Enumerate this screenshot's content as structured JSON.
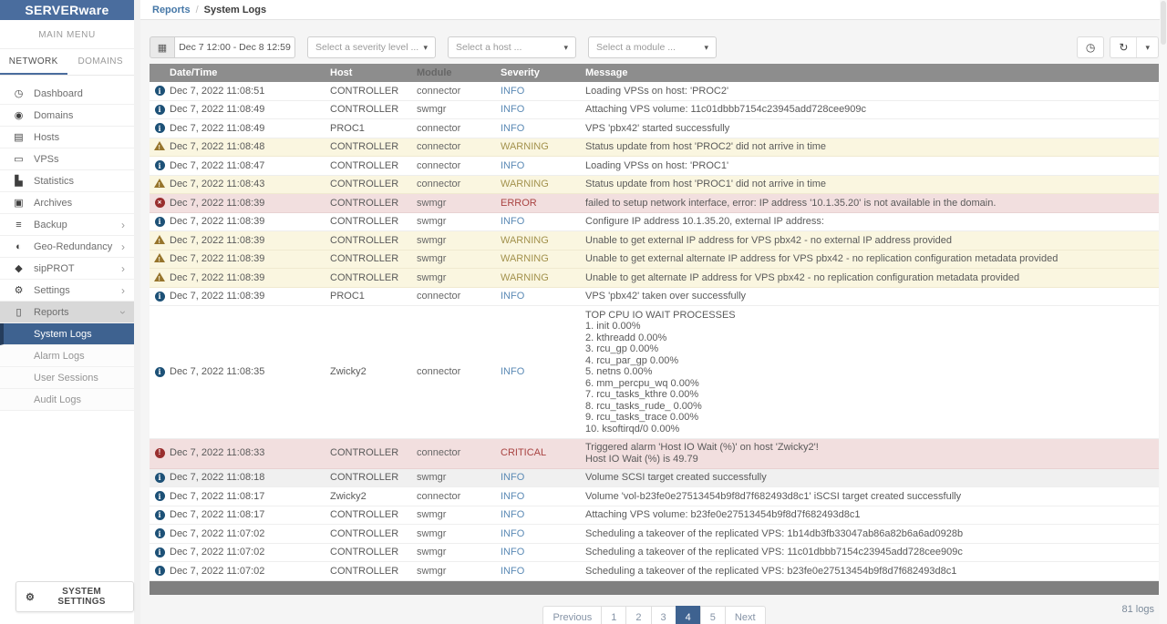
{
  "app": {
    "name": "SERVERware"
  },
  "colors": {
    "accent": "#4a6d9e",
    "info": "#5b8ab5",
    "warning": "#a3924d",
    "error": "#a94442",
    "warning_row": "#faf6e0",
    "error_row": "#f2dfdf",
    "table_header": "#8d8d8d"
  },
  "icons": {
    "calendar": "▦",
    "history": "◷",
    "refresh": "↻",
    "caret": "▾",
    "gear": "⚙"
  },
  "sidebar": {
    "main_menu_label": "MAIN MENU",
    "tabs": [
      {
        "label": "NETWORK"
      },
      {
        "label": "DOMAINS"
      }
    ],
    "items": [
      {
        "label": "Dashboard",
        "glyph": "◷"
      },
      {
        "label": "Domains",
        "glyph": "◉"
      },
      {
        "label": "Hosts",
        "glyph": "▤"
      },
      {
        "label": "VPSs",
        "glyph": "▭"
      },
      {
        "label": "Statistics",
        "glyph": "▙"
      },
      {
        "label": "Archives",
        "glyph": "▣"
      },
      {
        "label": "Backup",
        "glyph": "≡",
        "chevron": "›"
      },
      {
        "label": "Geo-Redundancy",
        "glyph": "◐",
        "chevron": "›"
      },
      {
        "label": "sipPROT",
        "glyph": "◆",
        "chevron": "›"
      },
      {
        "label": "Settings",
        "glyph": "⚙",
        "chevron": "›"
      },
      {
        "label": "Reports",
        "glyph": "▯",
        "chevron": "›"
      }
    ],
    "subitems": [
      {
        "label": "System Logs"
      },
      {
        "label": "Alarm Logs"
      },
      {
        "label": "User Sessions"
      },
      {
        "label": "Audit Logs"
      }
    ],
    "system_settings_label": "SYSTEM SETTINGS"
  },
  "breadcrumb": {
    "parent": "Reports",
    "separator": "/",
    "current": "System Logs"
  },
  "filters": {
    "date_range": "Dec 7 12:00 - Dec 8 12:59",
    "severity_placeholder": "Select a severity level ...",
    "host_placeholder": "Select a host ...",
    "module_placeholder": "Select a module ..."
  },
  "table": {
    "columns": [
      "Date/Time",
      "Host",
      "Module",
      "Severity",
      "Message"
    ],
    "rows": [
      {
        "sev": "info",
        "datetime": "Dec 7, 2022 11:08:51",
        "host": "CONTROLLER",
        "module": "connector",
        "severity": "INFO",
        "message": "Loading VPSs on host: 'PROC2'"
      },
      {
        "sev": "info",
        "datetime": "Dec 7, 2022 11:08:49",
        "host": "CONTROLLER",
        "module": "swmgr",
        "severity": "INFO",
        "message": "Attaching VPS volume: 11c01dbbb7154c23945add728cee909c"
      },
      {
        "sev": "info",
        "datetime": "Dec 7, 2022 11:08:49",
        "host": "PROC1",
        "module": "connector",
        "severity": "INFO",
        "message": "VPS 'pbx42' started successfully"
      },
      {
        "sev": "warning",
        "datetime": "Dec 7, 2022 11:08:48",
        "host": "CONTROLLER",
        "module": "connector",
        "severity": "WARNING",
        "message": "Status update from host 'PROC2' did not arrive in time"
      },
      {
        "sev": "info",
        "datetime": "Dec 7, 2022 11:08:47",
        "host": "CONTROLLER",
        "module": "connector",
        "severity": "INFO",
        "message": "Loading VPSs on host: 'PROC1'"
      },
      {
        "sev": "warning",
        "datetime": "Dec 7, 2022 11:08:43",
        "host": "CONTROLLER",
        "module": "connector",
        "severity": "WARNING",
        "message": "Status update from host 'PROC1' did not arrive in time"
      },
      {
        "sev": "error",
        "datetime": "Dec 7, 2022 11:08:39",
        "host": "CONTROLLER",
        "module": "swmgr",
        "severity": "ERROR",
        "message": "failed to setup network interface, error: IP address '10.1.35.20' is not available in the domain."
      },
      {
        "sev": "info",
        "datetime": "Dec 7, 2022 11:08:39",
        "host": "CONTROLLER",
        "module": "swmgr",
        "severity": "INFO",
        "message": "Configure IP address 10.1.35.20, external IP address:"
      },
      {
        "sev": "warning",
        "datetime": "Dec 7, 2022 11:08:39",
        "host": "CONTROLLER",
        "module": "swmgr",
        "severity": "WARNING",
        "message": "Unable to get external IP address for VPS pbx42 - no external IP address provided"
      },
      {
        "sev": "warning",
        "datetime": "Dec 7, 2022 11:08:39",
        "host": "CONTROLLER",
        "module": "swmgr",
        "severity": "WARNING",
        "message": "Unable to get external alternate IP address for VPS pbx42 - no replication configuration metadata provided"
      },
      {
        "sev": "warning",
        "datetime": "Dec 7, 2022 11:08:39",
        "host": "CONTROLLER",
        "module": "swmgr",
        "severity": "WARNING",
        "message": "Unable to get alternate IP address for VPS pbx42 - no replication configuration metadata provided"
      },
      {
        "sev": "info",
        "datetime": "Dec 7, 2022 11:08:39",
        "host": "PROC1",
        "module": "connector",
        "severity": "INFO",
        "message": "VPS 'pbx42' taken over successfully"
      },
      {
        "sev": "info",
        "datetime": "Dec 7, 2022 11:08:35",
        "host": "Zwicky2",
        "module": "connector",
        "severity": "INFO",
        "message": "TOP CPU IO WAIT PROCESSES\n1. init 0.00%\n2. kthreadd 0.00%\n3. rcu_gp 0.00%\n4. rcu_par_gp 0.00%\n5. netns 0.00%\n6. mm_percpu_wq 0.00%\n7. rcu_tasks_kthre 0.00%\n8. rcu_tasks_rude_ 0.00%\n9. rcu_tasks_trace 0.00%\n10. ksoftirqd/0 0.00%"
      },
      {
        "sev": "critical",
        "datetime": "Dec 7, 2022 11:08:33",
        "host": "CONTROLLER",
        "module": "connector",
        "severity": "CRITICAL",
        "message": "Triggered alarm 'Host IO Wait (%)' on host 'Zwicky2'!\nHost IO Wait (%) is 49.79"
      },
      {
        "sev": "info-muted",
        "datetime": "Dec 7, 2022 11:08:18",
        "host": "CONTROLLER",
        "module": "swmgr",
        "severity": "INFO",
        "message": "Volume SCSI target created successfully"
      },
      {
        "sev": "info",
        "datetime": "Dec 7, 2022 11:08:17",
        "host": "Zwicky2",
        "module": "connector",
        "severity": "INFO",
        "message": "Volume 'vol-b23fe0e27513454b9f8d7f682493d8c1' iSCSI target created successfully"
      },
      {
        "sev": "info",
        "datetime": "Dec 7, 2022 11:08:17",
        "host": "CONTROLLER",
        "module": "swmgr",
        "severity": "INFO",
        "message": "Attaching VPS volume: b23fe0e27513454b9f8d7f682493d8c1"
      },
      {
        "sev": "info",
        "datetime": "Dec 7, 2022 11:07:02",
        "host": "CONTROLLER",
        "module": "swmgr",
        "severity": "INFO",
        "message": "Scheduling a takeover of the replicated VPS: 1b14db3fb33047ab86a82b6a6ad0928b"
      },
      {
        "sev": "info",
        "datetime": "Dec 7, 2022 11:07:02",
        "host": "CONTROLLER",
        "module": "swmgr",
        "severity": "INFO",
        "message": "Scheduling a takeover of the replicated VPS: 11c01dbbb7154c23945add728cee909c"
      },
      {
        "sev": "info",
        "datetime": "Dec 7, 2022 11:07:02",
        "host": "CONTROLLER",
        "module": "swmgr",
        "severity": "INFO",
        "message": "Scheduling a takeover of the replicated VPS: b23fe0e27513454b9f8d7f682493d8c1"
      }
    ]
  },
  "pagination": {
    "previous": "Previous",
    "pages": [
      "1",
      "2",
      "3",
      "4",
      "5"
    ],
    "active_page": "4",
    "next": "Next",
    "total_label": "81 logs"
  }
}
